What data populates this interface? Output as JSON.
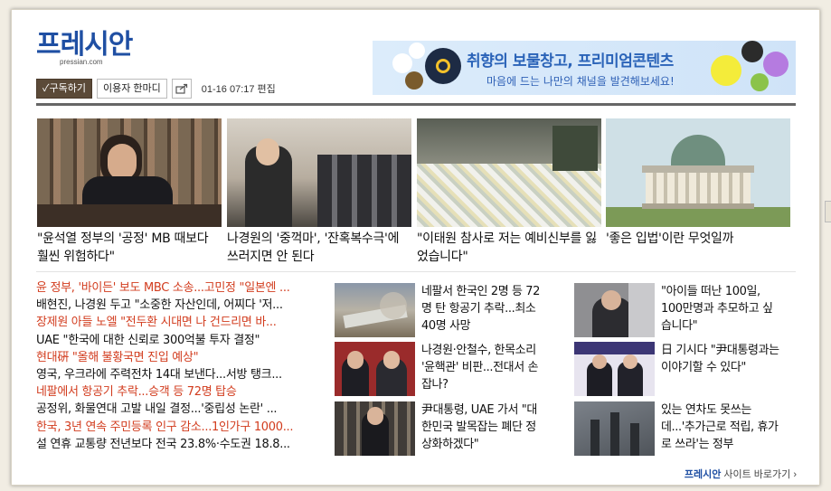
{
  "site": {
    "logo_text": "프레시안",
    "logo_url": "pressian.com"
  },
  "banner": {
    "headline": "취향의 보물창고, 프리미엄콘텐츠",
    "subline": "마음에 드는 나만의 채널을 발견해보세요!"
  },
  "toolbar": {
    "subscribe_label": "✓구독하기",
    "comment_label": "이용자 한마디",
    "date_text": "01-16 07:17 편집"
  },
  "top_stories": [
    {
      "title": "\"윤석열 정부의 '공정' MB 때보다 훨씬 위험하다\""
    },
    {
      "title": "나경원의 '중꺽마', '잔혹복수극'에 쓰러지면 안 된다"
    },
    {
      "title": "\"이태원 참사로 저는 예비신부를 잃었습니다\""
    },
    {
      "title": "'좋은 입법'이란 무엇일까"
    }
  ],
  "news_list": [
    {
      "text": "윤 정부, '바이든' 보도 MBC 소송...고민정 \"일본엔 ...",
      "highlight": true
    },
    {
      "text": "배현진, 나경원 두고 \"소중한 자산인데, 어찌다 '저...",
      "highlight": false
    },
    {
      "text": "장제원 아들 노엘 \"전두환 시대면 나 건드리면 바...",
      "highlight": true
    },
    {
      "text": "UAE \"한국에 대한 신뢰로 300억불 투자 결정\"",
      "highlight": false
    },
    {
      "text": "현대硏 \"올해 불황국면 진입 예상\"",
      "highlight": true
    },
    {
      "text": "영국, 우크라에 주력전차 14대 보낸다...서방 탱크...",
      "highlight": false
    },
    {
      "text": "네팔에서 항공기 추락...승객 등 72명 탑승",
      "highlight": true
    },
    {
      "text": "공정위, 화물연대 고발 내일 결정...'중립성 논란' ...",
      "highlight": false
    },
    {
      "text": "한국, 3년 연속 주민등록 인구 감소...1인가구 1000...",
      "highlight": true
    },
    {
      "text": "설 연휴 교통량 전년보다 전국 23.8%·수도권 18.8...",
      "highlight": false
    }
  ],
  "mid_stories": [
    {
      "title": "네팔서 한국인 2명 등 72명 탄 항공기 추락...최소 40명 사망"
    },
    {
      "title": "나경원·안철수, 한목소리 '윤핵관' 비판...전대서 손잡나?"
    },
    {
      "title": "尹대통령, UAE 가서 \"대한민국 발목잡는 폐단 정상화하겠다\""
    }
  ],
  "right_stories": [
    {
      "title": "\"아이들 떠난 100일, 100만명과 추모하고 싶습니다\""
    },
    {
      "title": "日 기시다 \"尹대통령과는 이야기할 수 있다\""
    },
    {
      "title": "있는 연차도 못쓰는데...'추가근로 적립, 휴가로 쓰라'는 정부"
    }
  ],
  "footer": {
    "brand": "프레시안",
    "link_text": " 사이트 바로가기 ›"
  },
  "colors": {
    "brand_blue": "#1f4fa3",
    "highlight_red": "#d23c1e",
    "subscribe_brown": "#5b4a38"
  }
}
